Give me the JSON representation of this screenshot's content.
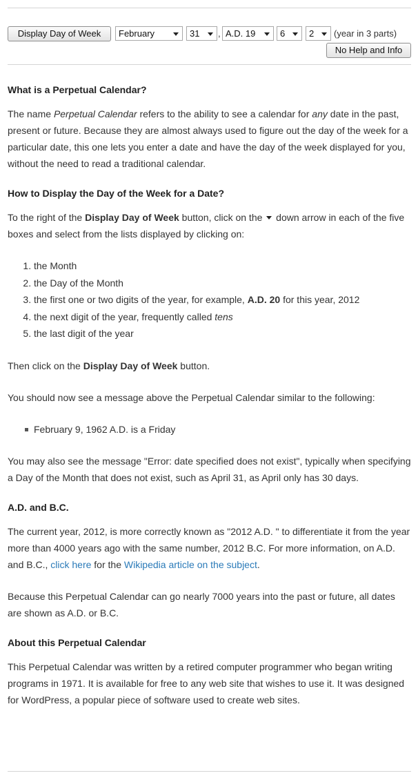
{
  "controls": {
    "display_button": "Display Day of Week",
    "month": "February",
    "day": "31",
    "separator": ",",
    "era": "A.D. 19",
    "tens": "6",
    "units": "2",
    "year_note": "(year in 3 parts)",
    "help_button": "No Help and Info"
  },
  "sections": {
    "perpetual": {
      "heading": "What is a Perpetual Calendar?",
      "p1_a": "The name ",
      "p1_em1": "Perpetual Calendar",
      "p1_b": " refers to the ability to see a calendar for ",
      "p1_em2": "any",
      "p1_c": " date in the past, present or future. Because they are almost always used to figure out the day of the week for a particular date, this one lets you enter a date and have the day of the week displayed for you, without the need to read a traditional calendar."
    },
    "howto": {
      "heading": "How to Display the Day of the Week for a Date?",
      "p1_a": "To the right of the ",
      "p1_bold": "Display Day of Week",
      "p1_b": " button, click on the ",
      "p1_c": " down arrow in each of the five boxes and select from the lists displayed by clicking on:",
      "steps": {
        "s1": "the Month",
        "s2": "the Day of the Month",
        "s3_a": "the first one or two digits of the year, for example, ",
        "s3_bold": "A.D. 20",
        "s3_b": " for this year, 2012",
        "s4_a": "the next digit of the year, frequently called ",
        "s4_em": "tens",
        "s5": "the last digit of the year"
      },
      "then_a": "Then click on the ",
      "then_bold": "Display Day of Week",
      "then_b": " button.",
      "should_see": "You should now see a message above the Perpetual Calendar similar to the following:",
      "example_message": "February 9, 1962 A.D. is a Friday",
      "error_note": "You may also see the message \"Error: date specified does not exist\", typically when specifying a Day of the Month that does not exist, such as April 31, as April only has 30 days."
    },
    "adbc": {
      "heading": "A.D. and B.C.",
      "p1_a": "The current year, 2012, is more correctly known as \"2012 A.D. \" to differentiate it from the year more than 4000 years ago with the same number, 2012 B.C. For more information, on A.D. and B.C., ",
      "link1": "click here",
      "p1_b": " for the ",
      "link2": "Wikipedia article on the subject",
      "p1_c": ".",
      "p2": "Because this Perpetual Calendar can go nearly 7000 years into the past or future, all dates are shown as A.D. or B.C."
    },
    "about": {
      "heading": "About this Perpetual Calendar",
      "p1": "This Perpetual Calendar was written by a retired computer programmer who began writing programs in 1971. It is available for free to any web site that wishes to use it. It was designed for WordPress, a popular piece of software used to create web sites."
    }
  }
}
